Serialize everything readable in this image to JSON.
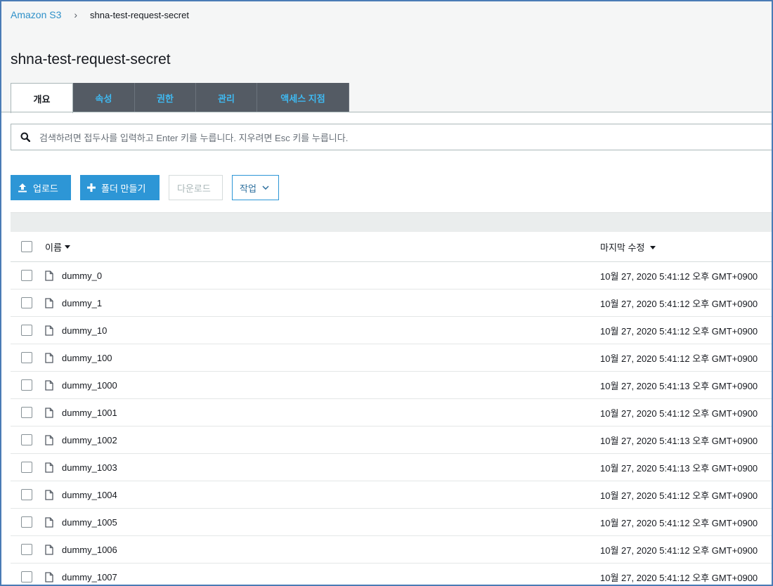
{
  "breadcrumb": {
    "root": "Amazon S3",
    "separator": "›",
    "current": "shna-test-request-secret"
  },
  "title": "shna-test-request-secret",
  "tabs": [
    {
      "label": "개요",
      "active": true
    },
    {
      "label": "속성",
      "active": false
    },
    {
      "label": "권한",
      "active": false
    },
    {
      "label": "관리",
      "active": false
    },
    {
      "label": "액세스 지점",
      "active": false
    }
  ],
  "search": {
    "placeholder": "검색하려면 접두사를 입력하고 Enter 키를 누릅니다. 지우려면 Esc 키를 누릅니다.",
    "icon": "search-icon"
  },
  "toolbar": {
    "upload_label": "업로드",
    "create_folder_label": "폴더 만들기",
    "download_label": "다운로드",
    "actions_label": "작업"
  },
  "table": {
    "columns": {
      "name": "이름",
      "last_modified": "마지막 수정"
    },
    "rows": [
      {
        "name": "dummy_0",
        "modified": "10월 27, 2020 5:41:12 오후 GMT+0900"
      },
      {
        "name": "dummy_1",
        "modified": "10월 27, 2020 5:41:12 오후 GMT+0900"
      },
      {
        "name": "dummy_10",
        "modified": "10월 27, 2020 5:41:12 오후 GMT+0900"
      },
      {
        "name": "dummy_100",
        "modified": "10월 27, 2020 5:41:12 오후 GMT+0900"
      },
      {
        "name": "dummy_1000",
        "modified": "10월 27, 2020 5:41:13 오후 GMT+0900"
      },
      {
        "name": "dummy_1001",
        "modified": "10월 27, 2020 5:41:12 오후 GMT+0900"
      },
      {
        "name": "dummy_1002",
        "modified": "10월 27, 2020 5:41:13 오후 GMT+0900"
      },
      {
        "name": "dummy_1003",
        "modified": "10월 27, 2020 5:41:13 오후 GMT+0900"
      },
      {
        "name": "dummy_1004",
        "modified": "10월 27, 2020 5:41:12 오후 GMT+0900"
      },
      {
        "name": "dummy_1005",
        "modified": "10월 27, 2020 5:41:12 오후 GMT+0900"
      },
      {
        "name": "dummy_1006",
        "modified": "10월 27, 2020 5:41:12 오후 GMT+0900"
      },
      {
        "name": "dummy_1007",
        "modified": "10월 27, 2020 5:41:12 오후 GMT+0900"
      }
    ]
  },
  "colors": {
    "link": "#2e90c9",
    "primary_button": "#2d96d6",
    "tab_bg": "#545b64",
    "tab_text": "#3fb9f1",
    "frame_border": "#4a7bb5"
  }
}
